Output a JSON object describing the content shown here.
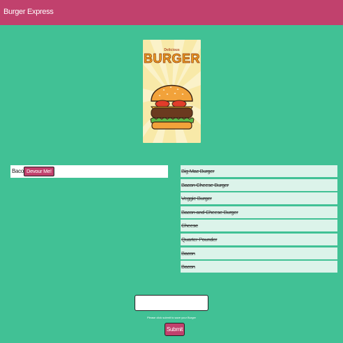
{
  "navbar": {
    "brand": "Burger Express"
  },
  "poster": {
    "small_title": "Delicious",
    "big_title": "BURGER"
  },
  "to_devour": [
    {
      "name": "Bacon",
      "button_label": "Devour Me!"
    }
  ],
  "devoured": [
    "Big Mac Burger",
    "Bacon Cheese Burger",
    "Veggie Burger",
    "Bacon and Cheese Burger",
    "Cheese",
    "Quarter Pounder",
    "Bacon",
    "Bacon"
  ],
  "form": {
    "input_value": "",
    "hint": "Please click submit to save your Burger",
    "submit_label": "Submit"
  },
  "colors": {
    "background": "#41c195",
    "navbar": "#c1416d",
    "button": "#c1416d",
    "devoured_item_bg": "#dcf3ea"
  }
}
